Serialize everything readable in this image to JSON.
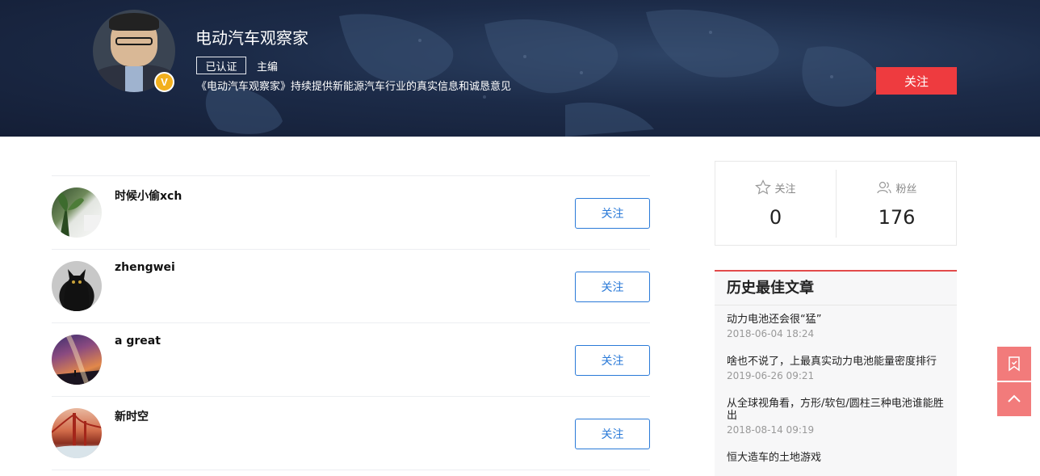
{
  "header": {
    "author_name": "电动汽车观察家",
    "verified_label": "已认证",
    "role": "主编",
    "description": "《电动汽车观察家》持续提供新能源汽车行业的真实信息和诚恳意见",
    "badge_letter": "V",
    "follow_label": "关注"
  },
  "followers": [
    {
      "name": "时候小偷xch",
      "follow_label": "关注"
    },
    {
      "name": "zhengwei",
      "follow_label": "关注"
    },
    {
      "name": "a great",
      "follow_label": "关注"
    },
    {
      "name": "新时空",
      "follow_label": "关注"
    }
  ],
  "stats": {
    "following_label": "关注",
    "following_count": "0",
    "fans_label": "粉丝",
    "fans_count": "176"
  },
  "best_articles": {
    "title": "历史最佳文章",
    "items": [
      {
        "title": "动力电池还会很“猛”",
        "date": "2018-06-04 18:24"
      },
      {
        "title": "啥也不说了，上最真实动力电池能量密度排行",
        "date": "2019-06-26 09:21"
      },
      {
        "title": "从全球视角看，方形/软包/圆柱三种电池谁能胜出",
        "date": "2018-08-14 09:19"
      },
      {
        "title": "恒大造车的土地游戏",
        "date": ""
      }
    ]
  },
  "colors": {
    "accent_red": "#ee3b3f",
    "link_blue": "#2a7ad8",
    "banner_dark": "#1c2b48"
  }
}
